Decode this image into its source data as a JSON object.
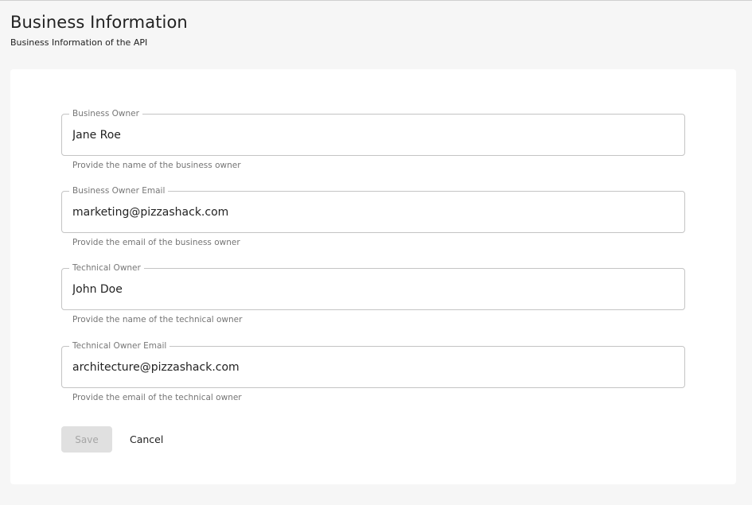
{
  "header": {
    "title": "Business Information",
    "subtitle": "Business Information of the API"
  },
  "form": {
    "fields": [
      {
        "label": "Business Owner",
        "value": "Jane Roe",
        "helper": "Provide the name of the business owner"
      },
      {
        "label": "Business Owner Email",
        "value": "marketing@pizzashack.com",
        "helper": "Provide the email of the business owner"
      },
      {
        "label": "Technical Owner",
        "value": "John Doe",
        "helper": "Provide the name of the technical owner"
      },
      {
        "label": "Technical Owner Email",
        "value": "architecture@pizzashack.com",
        "helper": "Provide the email of the technical owner"
      }
    ],
    "save_label": "Save",
    "cancel_label": "Cancel"
  }
}
